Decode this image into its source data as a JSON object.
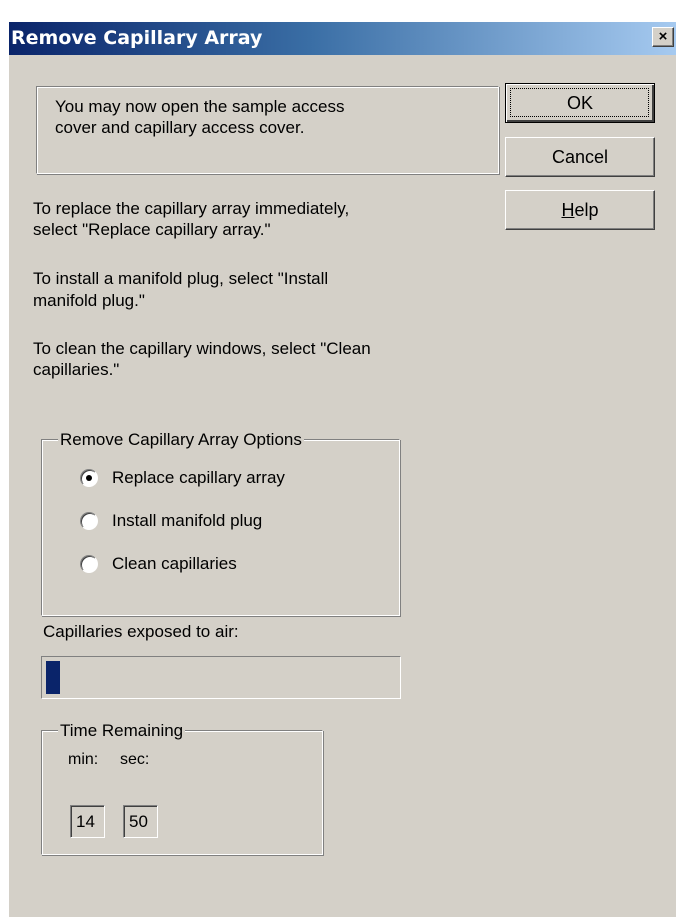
{
  "window": {
    "title": "Remove Capillary Array",
    "close_label": "×"
  },
  "message": {
    "line1": "You may now open the sample access",
    "line2": "cover and capillary access cover."
  },
  "buttons": {
    "ok": "OK",
    "cancel": "Cancel",
    "help": "Help"
  },
  "instructions": {
    "replace_line1": "To replace the capillary array immediately,",
    "replace_line2": "select \"Replace capillary array.\"",
    "install_line1": "To install a manifold plug, select \"Install",
    "install_line2": "manifold plug.\"",
    "clean_line1": "To clean the capillary windows, select \"Clean",
    "clean_line2": "capillaries.\""
  },
  "options_group": {
    "title": "Remove Capillary Array Options",
    "options": [
      {
        "label": "Replace capillary array",
        "checked": true
      },
      {
        "label": "Install manifold plug",
        "checked": false
      },
      {
        "label": "Clean capillaries",
        "checked": false
      }
    ]
  },
  "exposure": {
    "label": "Capillaries exposed to air:",
    "progress_fraction": 0.04
  },
  "time_group": {
    "title": "Time Remaining",
    "min_label": "min:",
    "sec_label": "sec:",
    "min_value": "14",
    "sec_value": "50"
  },
  "colors": {
    "dialog_face": "#d4d0c8",
    "title_active": "#0a246a",
    "progress": "#0a246a"
  },
  "icons": {
    "close": "close-icon"
  }
}
